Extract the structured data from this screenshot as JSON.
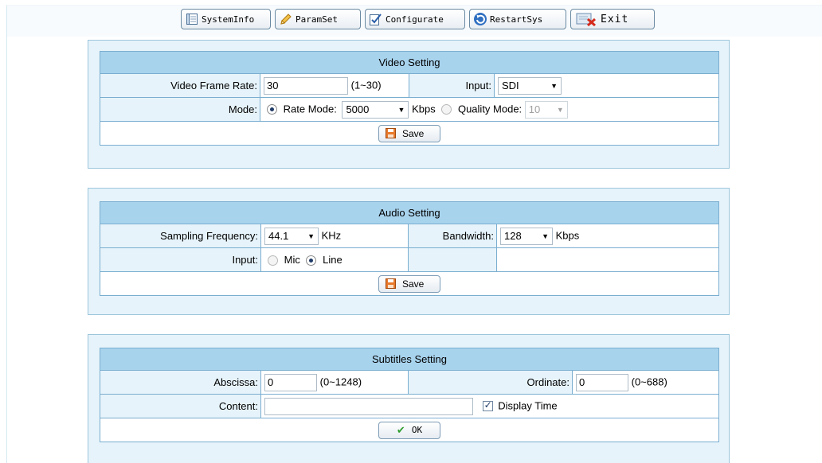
{
  "toolbar": {
    "system_info": "SystemInfo",
    "param_set": "ParamSet",
    "configurate": "Configurate",
    "restart_sys": "RestartSys",
    "exit": "Exit"
  },
  "video": {
    "title": "Video Setting",
    "frame_rate_label": "Video Frame Rate:",
    "frame_rate_value": "30",
    "frame_rate_range": "(1~30)",
    "input_label": "Input:",
    "input_value": "SDI",
    "mode_label": "Mode:",
    "rate_mode_label": "Rate Mode:",
    "rate_value": "5000",
    "rate_unit": "Kbps",
    "quality_mode_label": "Quality Mode:",
    "quality_value": "10",
    "save_label": "Save"
  },
  "audio": {
    "title": "Audio Setting",
    "sampling_label": "Sampling Frequency:",
    "sampling_value": "44.1",
    "sampling_unit": "KHz",
    "bandwidth_label": "Bandwidth:",
    "bandwidth_value": "128",
    "bandwidth_unit": "Kbps",
    "input_label": "Input:",
    "mic_label": "Mic",
    "line_label": "Line",
    "save_label": "Save"
  },
  "subtitles": {
    "title": "Subtitles Setting",
    "abscissa_label": "Abscissa:",
    "abscissa_value": "0",
    "abscissa_range": "(0~1248)",
    "ordinate_label": "Ordinate:",
    "ordinate_value": "0",
    "ordinate_range": "(0~688)",
    "content_label": "Content:",
    "content_value": "",
    "display_time_label": "Display Time",
    "ok_label": "OK"
  }
}
